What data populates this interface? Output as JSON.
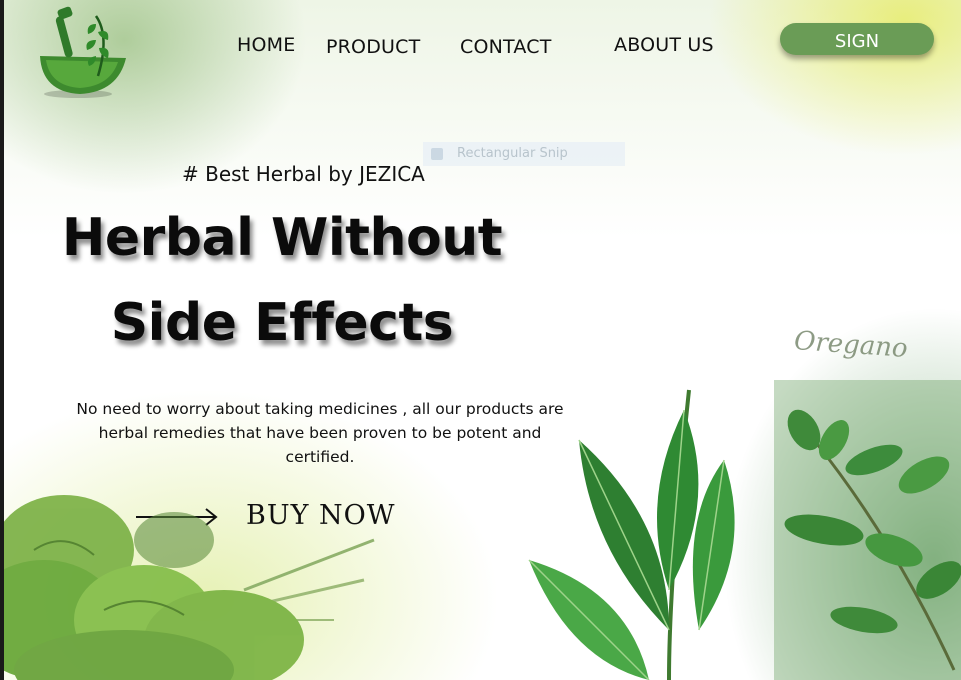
{
  "nav": {
    "items": [
      {
        "label": "HOME"
      },
      {
        "label": "PRODUCT"
      },
      {
        "label": "CONTACT"
      },
      {
        "label": "ABOUT US"
      }
    ],
    "sign_label": "SIGN"
  },
  "overlay": {
    "snip_label": "Rectangular Snip"
  },
  "hero": {
    "tagline": "# Best Herbal by JEZICA",
    "headline_line1": "Herbal Without",
    "headline_line2": "Side Effects",
    "description": "No need to worry about taking medicines , all our products are herbal remedies that have been proven to be potent and certified.",
    "cta_label": "BUY NOW"
  },
  "decor": {
    "herb_caption": "Oregano"
  },
  "colors": {
    "brand_green": "#6a9c56",
    "leaf_dark": "#2f7a2a",
    "highlight_yellow": "#e6eb5a"
  }
}
